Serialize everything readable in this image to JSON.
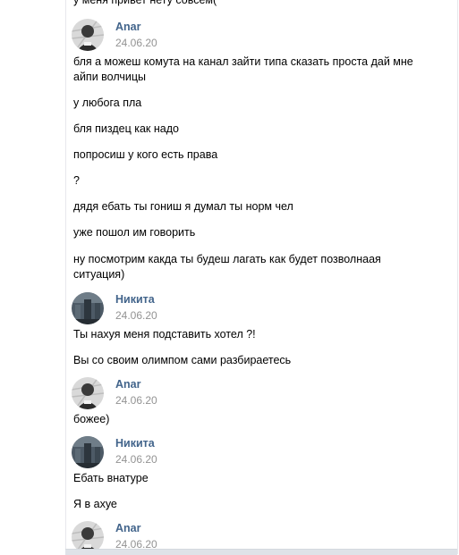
{
  "messages": [
    {
      "author": "",
      "date": "",
      "lines": [
        "у меня привет нету совсем("
      ]
    },
    {
      "author": "Anar",
      "date": "24.06.20",
      "avatar": "anar-avatar-icon",
      "lines": [
        "бля а можеш комута на канал зайти типа сказать проста дай мне\nайпи волчицы",
        "у любога пла",
        "бля пиздец как надо",
        "попросиш у кого есть права",
        "?",
        "дядя ебать ты гониш я думал ты норм чел",
        "уже пошол им говорить",
        "ну посмотрим какда ты будеш лагать как будет позволнаая\nситуация)"
      ]
    },
    {
      "author": "Никита",
      "date": "24.06.20",
      "avatar": "nikita-avatar-icon",
      "lines": [
        "Ты нахуя меня подставить хотел ?!",
        "Вы со своим олимпом сами разбираетесь"
      ]
    },
    {
      "author": "Anar",
      "date": "24.06.20",
      "avatar": "anar-avatar-icon",
      "lines": [
        "божее)"
      ]
    },
    {
      "author": "Никита",
      "date": "24.06.20",
      "avatar": "nikita-avatar-icon",
      "lines": [
        "Ебать внатуре",
        "Я в ахуе"
      ]
    },
    {
      "author": "Anar",
      "date": "24.06.20",
      "avatar": "anar-avatar-icon",
      "lines": []
    }
  ],
  "colors": {
    "author": "#42648b",
    "date": "#939393",
    "text": "#000000"
  }
}
